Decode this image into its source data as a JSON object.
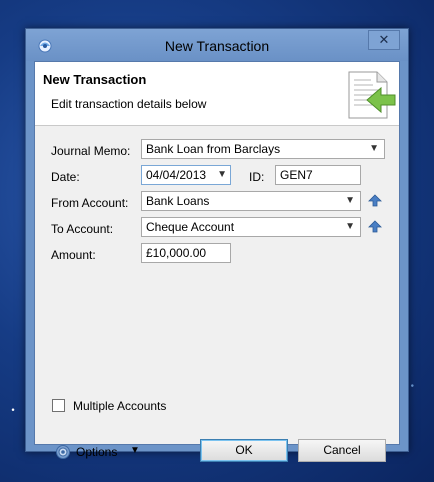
{
  "window": {
    "title": "New Transaction",
    "close_glyph": "✕"
  },
  "header": {
    "title": "New Transaction",
    "subtitle": "Edit transaction details below"
  },
  "form": {
    "journal_memo": {
      "label": "Journal Memo:",
      "value": "Bank Loan from Barclays"
    },
    "date": {
      "label": "Date:",
      "value": "04/04/2013"
    },
    "id": {
      "label": "ID:",
      "value": "GEN7"
    },
    "from_account": {
      "label": "From Account:",
      "value": "Bank Loans"
    },
    "to_account": {
      "label": "To Account:",
      "value": "Cheque Account"
    },
    "amount": {
      "label": "Amount:",
      "value": "£10,000.00"
    }
  },
  "multiple_accounts": {
    "label": "Multiple Accounts",
    "checked": false
  },
  "footer": {
    "options_label": "Options",
    "ok_label": "OK",
    "cancel_label": "Cancel"
  },
  "icons": {
    "app": "app-icon",
    "document": "document-arrow-icon",
    "dropdown": "chevron-down-icon",
    "up": "up-arrow-icon",
    "gear": "gear-icon"
  },
  "colors": {
    "titlebar": "#7ea3d4",
    "client_bg": "#f0f0f0",
    "default_button_border": "#3c7fb1"
  }
}
